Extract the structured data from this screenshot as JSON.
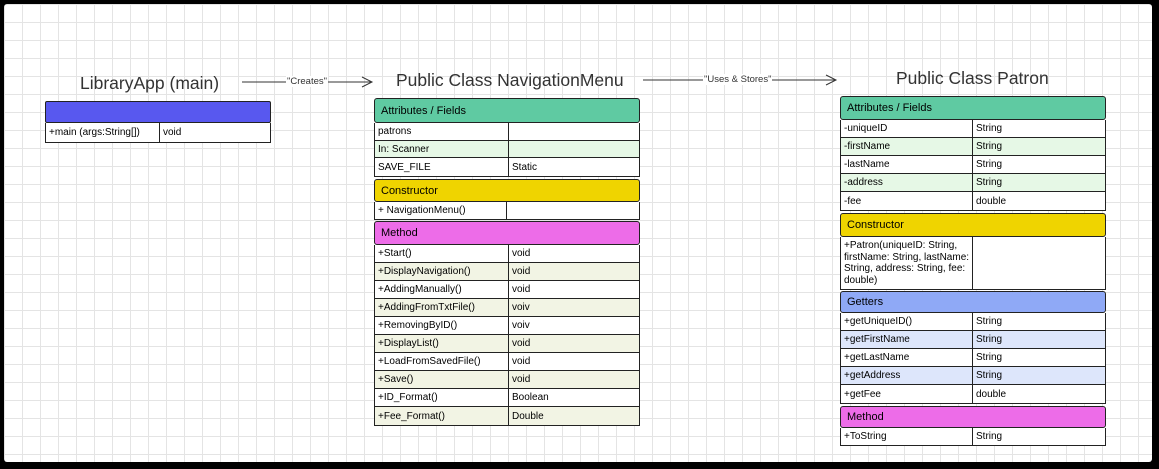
{
  "colors": {
    "main_header": "#5858ef",
    "attributes": "#5fcaa2",
    "constructor": "#efd400",
    "method": "#ed6ce8",
    "getters": "#8fa9f6"
  },
  "main_class": {
    "title": "LibraryApp (main)",
    "rows": [
      {
        "name": "+main (args:String[])",
        "type": "void"
      }
    ]
  },
  "arrows": {
    "creates": "\"Creates\"",
    "uses_stores": "\"Uses & Stores\""
  },
  "nav_menu": {
    "title": "Public Class NavigationMenu",
    "attributes_label": "Attributes  / Fields",
    "attributes": [
      {
        "name": "patrons",
        "type": ""
      },
      {
        "name": "In: Scanner",
        "type": ""
      },
      {
        "name": "SAVE_FILE",
        "type": "Static"
      }
    ],
    "constructor_label": "Constructor",
    "constructor": [
      {
        "name": "+ NavigationMenu()",
        "type": ""
      }
    ],
    "method_label": "Method",
    "methods": [
      {
        "name": "+Start()",
        "type": "void"
      },
      {
        "name": "+DisplayNavigation()",
        "type": "void"
      },
      {
        "name": "+AddingManually()",
        "type": "void"
      },
      {
        "name": "+AddingFromTxtFile()",
        "type": "voiv"
      },
      {
        "name": "+RemovingByID()",
        "type": "voiv"
      },
      {
        "name": "+DisplayList()",
        "type": "void"
      },
      {
        "name": "+LoadFromSavedFile()",
        "type": "void"
      },
      {
        "name": "+Save()",
        "type": "void"
      },
      {
        "name": "+ID_Format()",
        "type": "Boolean"
      },
      {
        "name": "+Fee_Format()",
        "type": "Double"
      }
    ]
  },
  "patron": {
    "title": "Public Class Patron",
    "attributes_label": "Attributes  / Fields",
    "attributes": [
      {
        "name": "-uniqueID",
        "type": "String"
      },
      {
        "name": "-firstName",
        "type": "String"
      },
      {
        "name": "-lastName",
        "type": "String"
      },
      {
        "name": "-address",
        "type": "String"
      },
      {
        "name": "-fee",
        "type": "double"
      }
    ],
    "constructor_label": "Constructor",
    "constructor": [
      {
        "name": "+Patron(uniqueID: String, firstName: String, lastName: String, address: String, fee: double)",
        "type": ""
      }
    ],
    "getters_label": "Getters",
    "getters": [
      {
        "name": "+getUniqueID()",
        "type": "String"
      },
      {
        "name": "+getFirstName",
        "type": "String"
      },
      {
        "name": "+getLastName",
        "type": "String"
      },
      {
        "name": "+getAddress",
        "type": "String"
      },
      {
        "name": "+getFee",
        "type": "double"
      }
    ],
    "method_label": "Method",
    "methods": [
      {
        "name": "+ToString",
        "type": "String"
      }
    ]
  }
}
